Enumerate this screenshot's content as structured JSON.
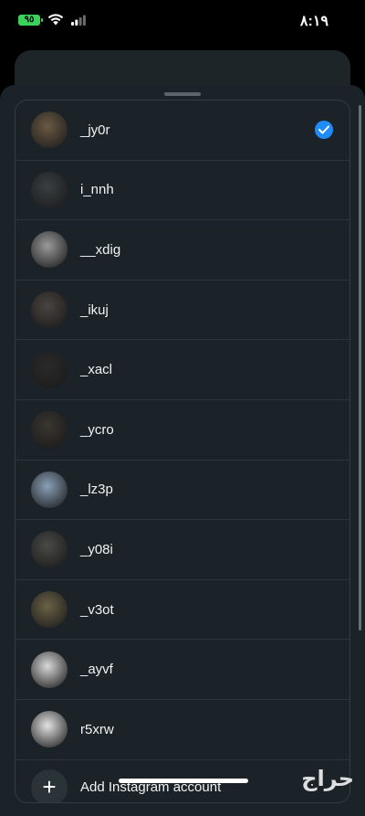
{
  "status_bar": {
    "battery": "٩٥",
    "time": "٨:١٩"
  },
  "accounts": [
    {
      "username": "_jy0r",
      "selected": true,
      "avatar_color": "#6b5a44"
    },
    {
      "username": "i_nnh",
      "selected": false,
      "avatar_color": "#3a3f42"
    },
    {
      "username": "__xdig",
      "selected": false,
      "avatar_color": "#9a9a9a"
    },
    {
      "username": "_ikuj",
      "selected": false,
      "avatar_color": "#4a4440"
    },
    {
      "username": "_xacl",
      "selected": false,
      "avatar_color": "#2a2a2a"
    },
    {
      "username": "_ycro",
      "selected": false,
      "avatar_color": "#3a3630"
    },
    {
      "username": "_lz3p",
      "selected": false,
      "avatar_color": "#8aa0b8"
    },
    {
      "username": "_y08i",
      "selected": false,
      "avatar_color": "#4a4a46"
    },
    {
      "username": "_v3ot",
      "selected": false,
      "avatar_color": "#6a6246"
    },
    {
      "username": "_ayvf",
      "selected": false,
      "avatar_color": "#d8d8d8"
    },
    {
      "username": "r5xrw",
      "selected": false,
      "avatar_color": "#e2e2e2"
    }
  ],
  "add_account": {
    "label": "Add Instagram account",
    "icon": "+"
  },
  "watermark": "حراج",
  "colors": {
    "accent": "#1f8cf7",
    "sheet_bg": "#1b2328"
  }
}
